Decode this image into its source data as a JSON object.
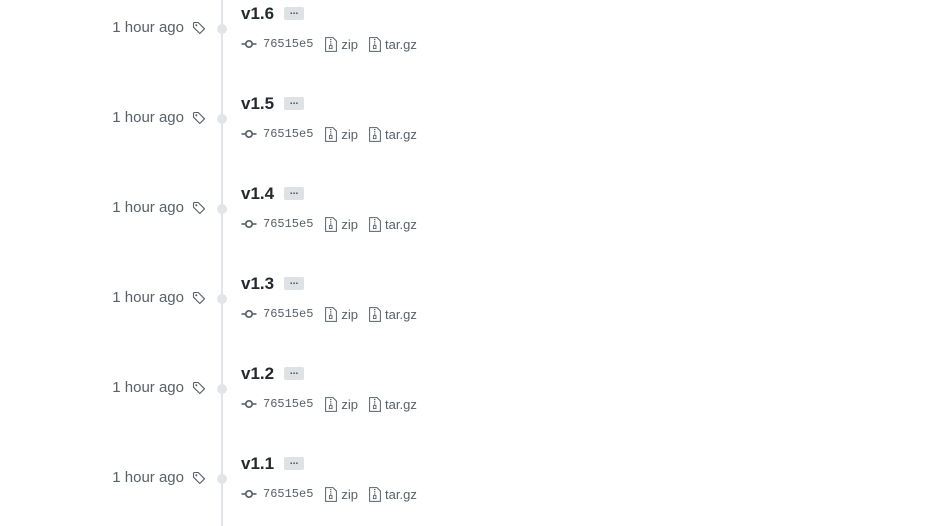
{
  "tags": [
    {
      "name": "v1.6",
      "time": "1 hour ago",
      "sha": "76515e5",
      "ellipsis": "...",
      "zip": "zip",
      "tar": "tar.gz"
    },
    {
      "name": "v1.5",
      "time": "1 hour ago",
      "sha": "76515e5",
      "ellipsis": "...",
      "zip": "zip",
      "tar": "tar.gz"
    },
    {
      "name": "v1.4",
      "time": "1 hour ago",
      "sha": "76515e5",
      "ellipsis": "...",
      "zip": "zip",
      "tar": "tar.gz"
    },
    {
      "name": "v1.3",
      "time": "1 hour ago",
      "sha": "76515e5",
      "ellipsis": "...",
      "zip": "zip",
      "tar": "tar.gz"
    },
    {
      "name": "v1.2",
      "time": "1 hour ago",
      "sha": "76515e5",
      "ellipsis": "...",
      "zip": "zip",
      "tar": "tar.gz"
    },
    {
      "name": "v1.1",
      "time": "1 hour ago",
      "sha": "76515e5",
      "ellipsis": "...",
      "zip": "zip",
      "tar": "tar.gz"
    }
  ],
  "icons": {
    "tag": "tag-icon",
    "commit": "git-commit-icon",
    "file": "file-zip-icon"
  },
  "colors": {
    "muted_text": "#586069",
    "title_text": "#24292e",
    "timeline": "#e1e4e8",
    "ellipsis_bg": "#dfe2e5"
  }
}
